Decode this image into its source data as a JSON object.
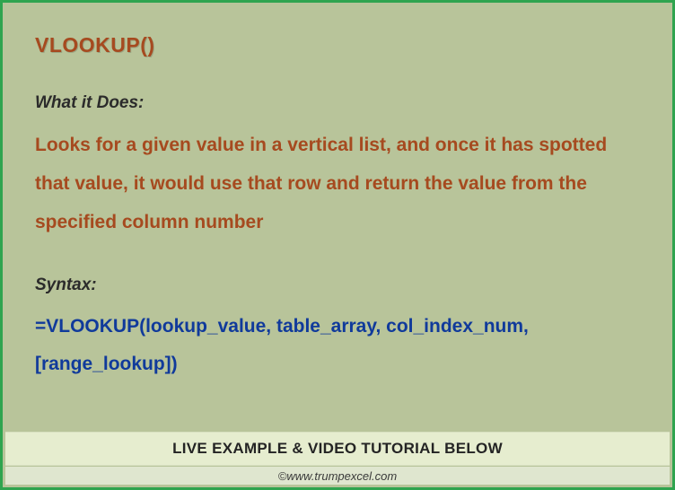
{
  "title": "VLOOKUP()",
  "whatItDoesLabel": "What it Does:",
  "whatItDoesText": "Looks for a given value in a vertical list, and once it has spotted that value, it would use that row and return the value from the specified column number",
  "syntaxLabel": "Syntax:",
  "syntaxText": "=VLOOKUP(lookup_value, table_array, col_index_num, [range_lookup])",
  "banner": "LIVE EXAMPLE & VIDEO TUTORIAL BELOW",
  "credit": "©www.trumpexcel.com"
}
